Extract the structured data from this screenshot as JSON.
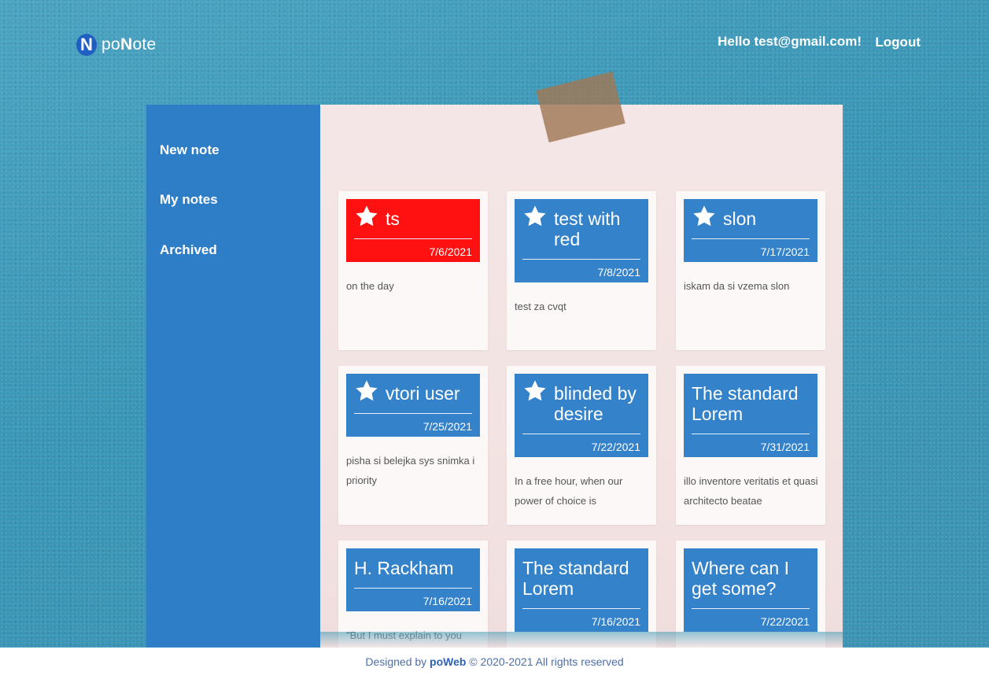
{
  "header": {
    "logo_letter": "N",
    "logo_text_pre": "po",
    "logo_text_bold": "N",
    "logo_text_post": "ote",
    "greeting": "Hello test@gmail.com!",
    "logout": "Logout"
  },
  "sidebar": {
    "items": [
      {
        "label": "New note"
      },
      {
        "label": "My notes"
      },
      {
        "label": "Archived"
      }
    ]
  },
  "notes": [
    {
      "title": "ts",
      "date": "7/6/2021",
      "body": "on the day",
      "starred": true,
      "color": "#ff1111"
    },
    {
      "title": "test with red",
      "date": "7/8/2021",
      "body": "test za cvqt",
      "starred": true,
      "color": "#3482ca"
    },
    {
      "title": "slon",
      "date": "7/17/2021",
      "body": "iskam da si vzema slon",
      "starred": true,
      "color": "#3482ca"
    },
    {
      "title": "vtori user",
      "date": "7/25/2021",
      "body": "pisha si belejka sys snimka i priority",
      "starred": true,
      "color": "#3482ca"
    },
    {
      "title": "blinded by desire",
      "date": "7/22/2021",
      "body": "In a free hour, when our power of choice is",
      "starred": true,
      "color": "#3482ca"
    },
    {
      "title": "The standard Lorem",
      "date": "7/31/2021",
      "body": "illo inventore veritatis et quasi architecto beatae",
      "starred": false,
      "color": "#3482ca"
    },
    {
      "title": "H. Rackham",
      "date": "7/16/2021",
      "body": "\"But I must explain to you",
      "starred": false,
      "color": "#3482ca"
    },
    {
      "title": "The standard Lorem",
      "date": "7/16/2021",
      "body": "",
      "starred": false,
      "color": "#3482ca"
    },
    {
      "title": "Where can I get some?",
      "date": "7/22/2021",
      "body": "",
      "starred": false,
      "color": "#3482ca"
    }
  ],
  "footer": {
    "pre": "Designed by ",
    "brand": "poWeb",
    "post": " © 2020-2021 All rights reserved"
  }
}
